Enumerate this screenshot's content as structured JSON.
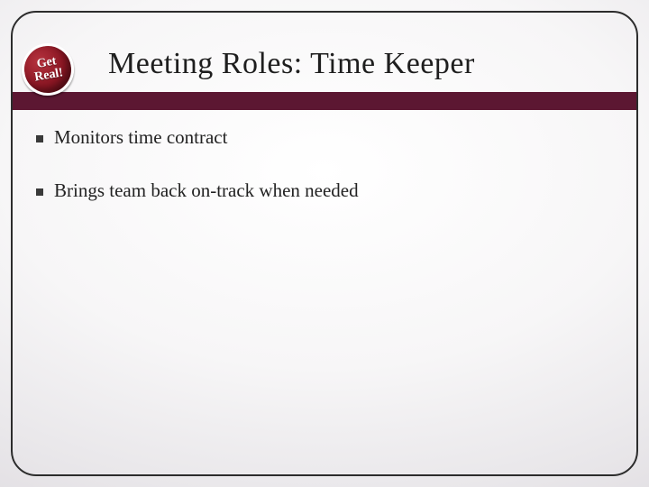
{
  "badge": {
    "line1": "Get",
    "line2": "Real!"
  },
  "title": "Meeting Roles:  Time Keeper",
  "bullets": [
    "Monitors time contract",
    "Brings team back on-track when needed"
  ]
}
